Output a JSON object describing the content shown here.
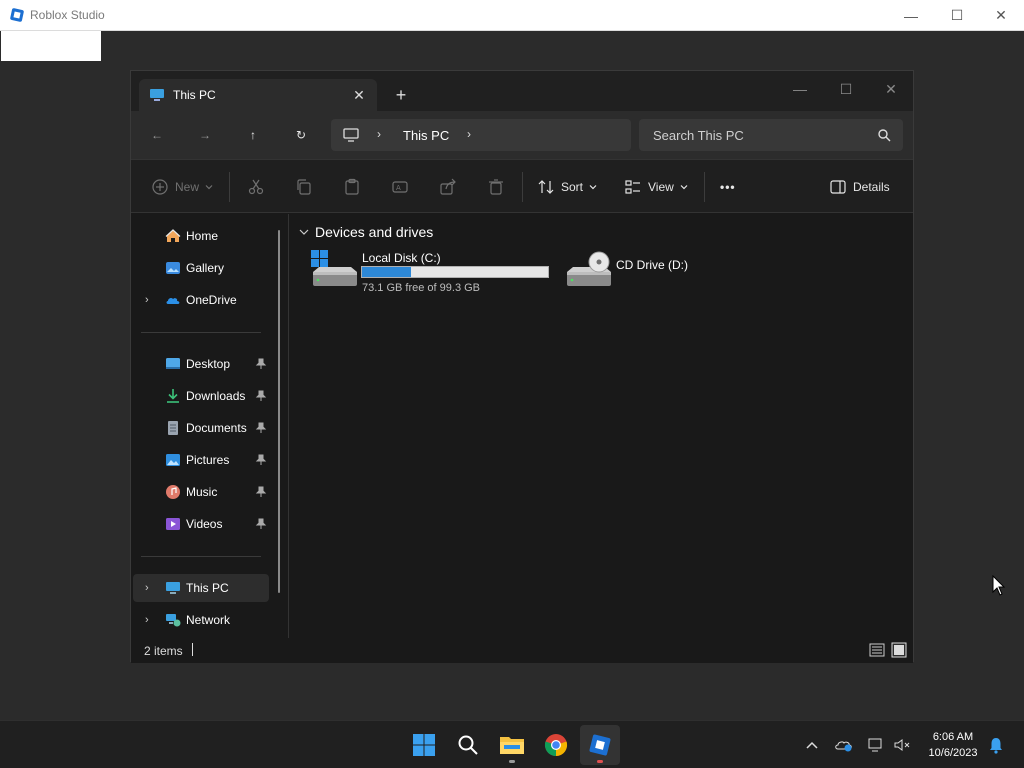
{
  "studio": {
    "title": "Roblox Studio",
    "controls": {
      "minimize": "—",
      "maximize": "☐",
      "close": "✕"
    }
  },
  "explorer": {
    "tab": {
      "label": "This PC",
      "close": "✕",
      "add": "+"
    },
    "window_controls": {
      "minimize": "—",
      "maximize": "☐",
      "close": "✕"
    },
    "nav": {
      "back": "←",
      "forward": "→",
      "up": "↑",
      "refresh": "↻"
    },
    "address": {
      "path": "This PC",
      "chev": "›"
    },
    "search": {
      "placeholder": "Search This PC"
    },
    "toolbar": {
      "new_label": "New",
      "sort_label": "Sort",
      "view_label": "View",
      "more_label": "•••",
      "details_label": "Details"
    },
    "sidebar": {
      "items": [
        {
          "label": "Home",
          "icon": "home-icon"
        },
        {
          "label": "Gallery",
          "icon": "gallery-icon"
        },
        {
          "label": "OneDrive",
          "icon": "onedrive-icon"
        },
        {
          "label": "Desktop",
          "icon": "desktop-icon"
        },
        {
          "label": "Downloads",
          "icon": "downloads-icon"
        },
        {
          "label": "Documents",
          "icon": "documents-icon"
        },
        {
          "label": "Pictures",
          "icon": "pictures-icon"
        },
        {
          "label": "Music",
          "icon": "music-icon"
        },
        {
          "label": "Videos",
          "icon": "videos-icon"
        },
        {
          "label": "This PC",
          "icon": "this-pc-icon"
        },
        {
          "label": "Network",
          "icon": "network-icon"
        }
      ]
    },
    "content": {
      "group_title": "Devices and drives",
      "drives": [
        {
          "name": "Local Disk (C:)",
          "free_text": "73.1 GB free of 99.3 GB",
          "used_fraction": 0.264
        },
        {
          "name": "CD Drive (D:)"
        }
      ]
    },
    "status": {
      "items": "2 items"
    }
  },
  "taskbar": {
    "clock_time": "6:06 AM",
    "clock_date": "10/6/2023"
  },
  "colors": {
    "accent": "#2d88d7",
    "window_bg": "#191919",
    "desktop_bg": "#2b2b2b"
  }
}
